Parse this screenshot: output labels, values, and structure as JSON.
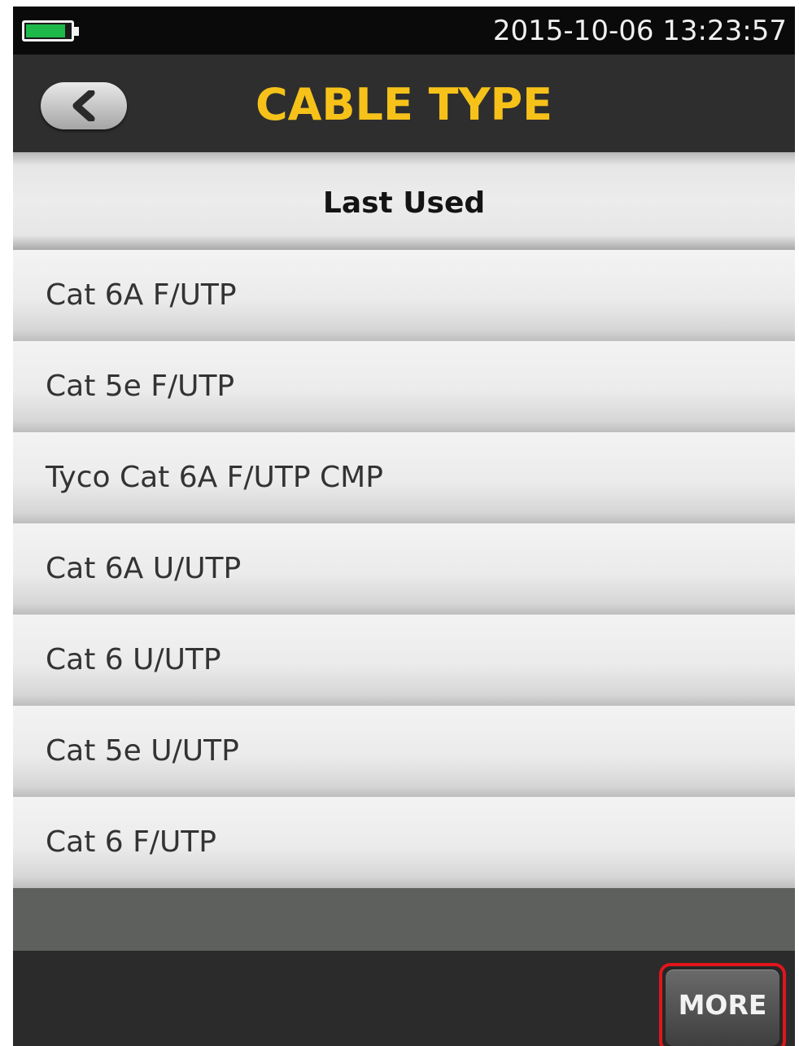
{
  "status_bar": {
    "datetime": "2015-10-06 13:23:57",
    "battery_level": 0.9,
    "battery_color": "#1fb84a"
  },
  "header": {
    "title": "CABLE TYPE",
    "title_color": "#f6c21a",
    "back_icon": "chevron-left-icon"
  },
  "section": {
    "label": "Last Used"
  },
  "cable_types": [
    {
      "label": "Cat 6A F/UTP"
    },
    {
      "label": "Cat 5e F/UTP"
    },
    {
      "label": "Tyco Cat 6A F/UTP CMP"
    },
    {
      "label": "Cat 6A U/UTP"
    },
    {
      "label": "Cat 6 U/UTP"
    },
    {
      "label": "Cat 5e U/UTP"
    },
    {
      "label": "Cat 6 F/UTP"
    }
  ],
  "footer": {
    "more_label": "MORE",
    "highlight_color": "#e0161c"
  }
}
